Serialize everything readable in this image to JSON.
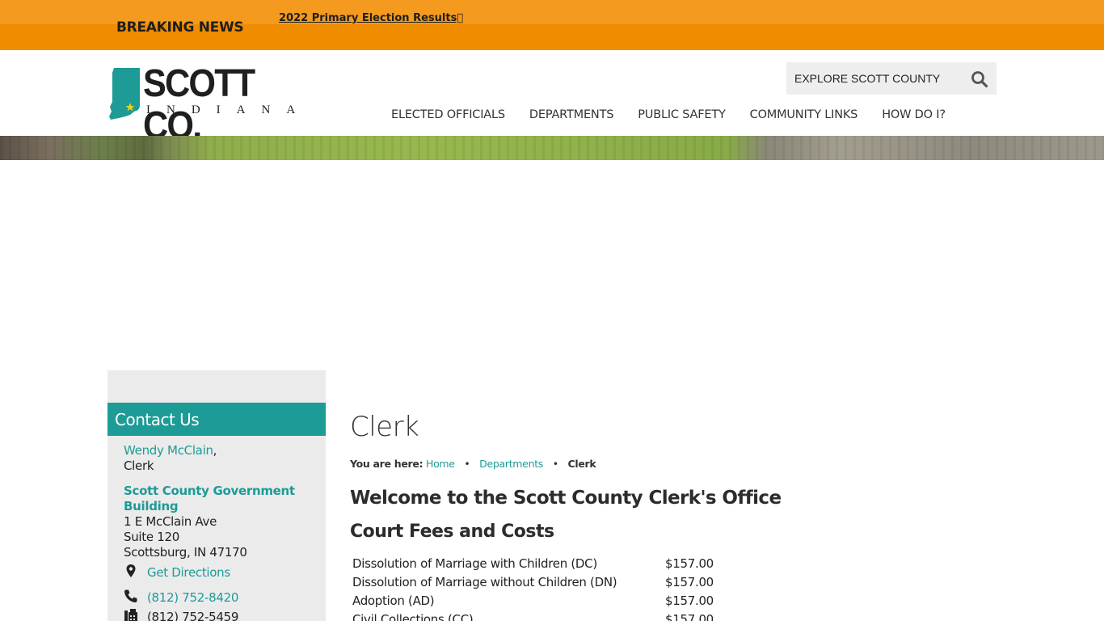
{
  "breaking_news": {
    "label": "BREAKING NEWS",
    "headline": "2022 Primary Election Results"
  },
  "header": {
    "logo_text": "SCOTT CO.",
    "logo_subtext": "INDIANA",
    "search_placeholder": "EXPLORE SCOTT COUNTY",
    "nav": [
      "ELECTED OFFICIALS",
      "DEPARTMENTS",
      "PUBLIC SAFETY",
      "COMMUNITY LINKS",
      "HOW DO I?"
    ]
  },
  "sidebar": {
    "contact_title": "Contact Us",
    "person_name": "Wendy McClain",
    "person_suffix": ",",
    "person_role": "Clerk",
    "building_name": "Scott County Government Building",
    "address_line1": "1 E McClain Ave",
    "address_line2": "Suite 120",
    "address_line3": "Scottsburg, IN 47170",
    "directions_label": "Get Directions",
    "phone": "(812) 752-8420",
    "fax": "(812) 752-5459"
  },
  "main": {
    "title": "Clerk",
    "breadcrumb_lead": "You are here:",
    "breadcrumb": [
      "Home",
      "Departments",
      "Clerk"
    ],
    "welcome_heading": "Welcome to the Scott County Clerk's Office",
    "fees_heading": "Court Fees and Costs",
    "fees": [
      {
        "name": "Dissolution of Marriage with Children (DC)",
        "amount": "$157.00"
      },
      {
        "name": "Dissolution of Marriage without Children (DN)",
        "amount": "$157.00"
      },
      {
        "name": "Adoption (AD)",
        "amount": "$157.00"
      },
      {
        "name": "Civil Collections (CC)",
        "amount": "$157.00"
      }
    ]
  },
  "colors": {
    "accent_teal": "#1d9b96",
    "news_orange": "#f08c00",
    "logo_teal": "#1d9b96"
  }
}
